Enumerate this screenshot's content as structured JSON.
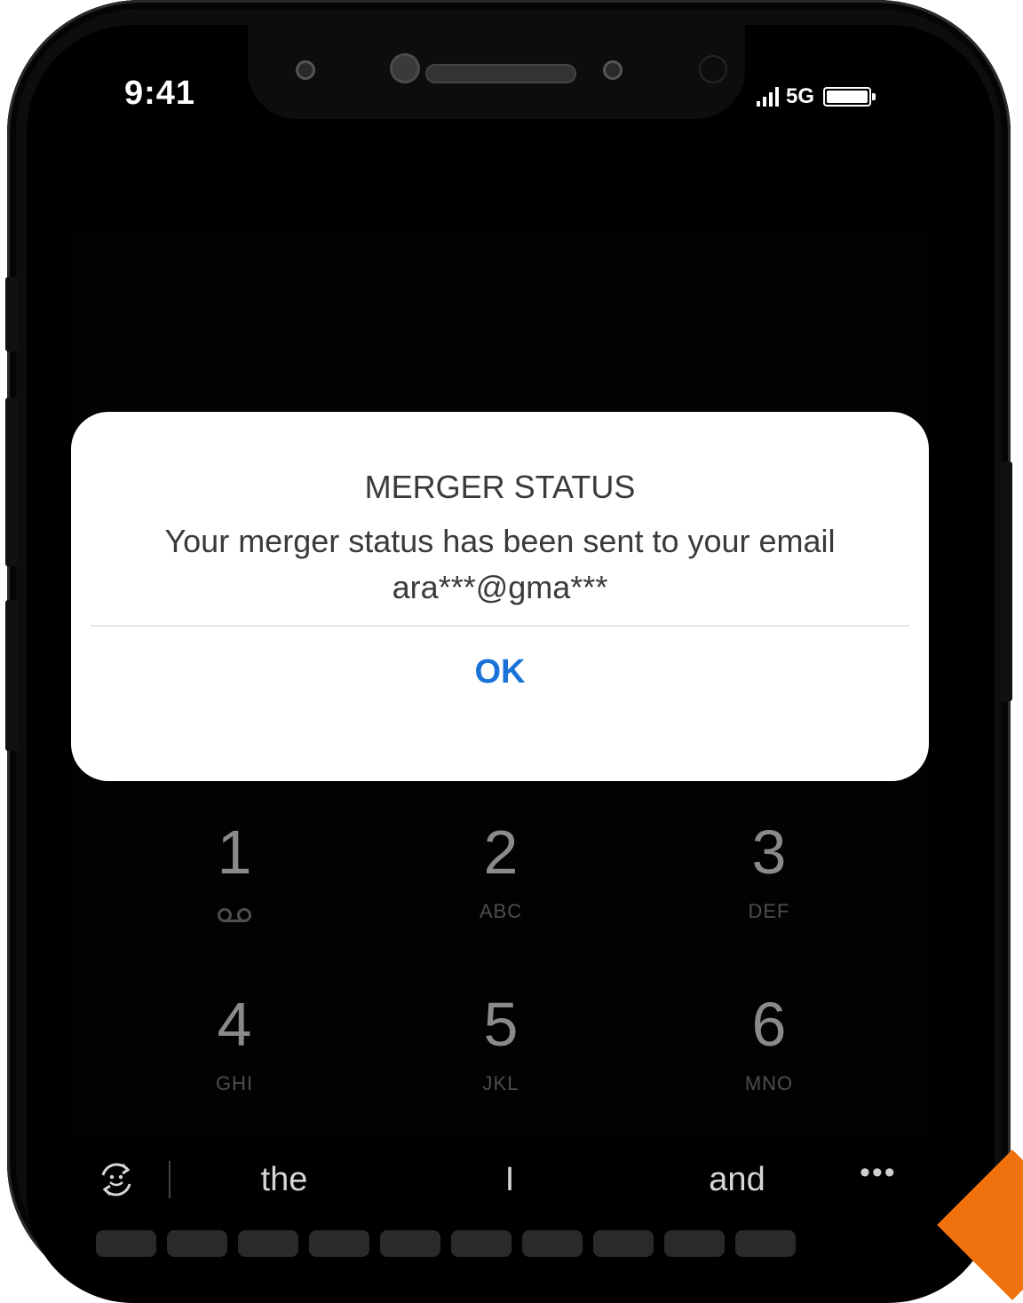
{
  "status_bar": {
    "time": "9:41",
    "network": "5G"
  },
  "dialog": {
    "title": "MERGER STATUS",
    "message": "Your merger status has been sent to your email ara***@gma***",
    "ok_label": "OK"
  },
  "dialpad": {
    "keys": [
      {
        "digit": "1",
        "letters": ""
      },
      {
        "digit": "2",
        "letters": "ABC"
      },
      {
        "digit": "3",
        "letters": "DEF"
      },
      {
        "digit": "4",
        "letters": "GHI"
      },
      {
        "digit": "5",
        "letters": "JKL"
      },
      {
        "digit": "6",
        "letters": "MNO"
      }
    ],
    "voicemail_icon": "voicemail-icon"
  },
  "keyboard": {
    "suggestions": [
      "the",
      "I",
      "and"
    ],
    "more_label": "•••",
    "emoji_icon": "emoji-refresh-icon"
  },
  "colors": {
    "accent": "#1a73d9",
    "brand_corner": "#f0720f"
  }
}
